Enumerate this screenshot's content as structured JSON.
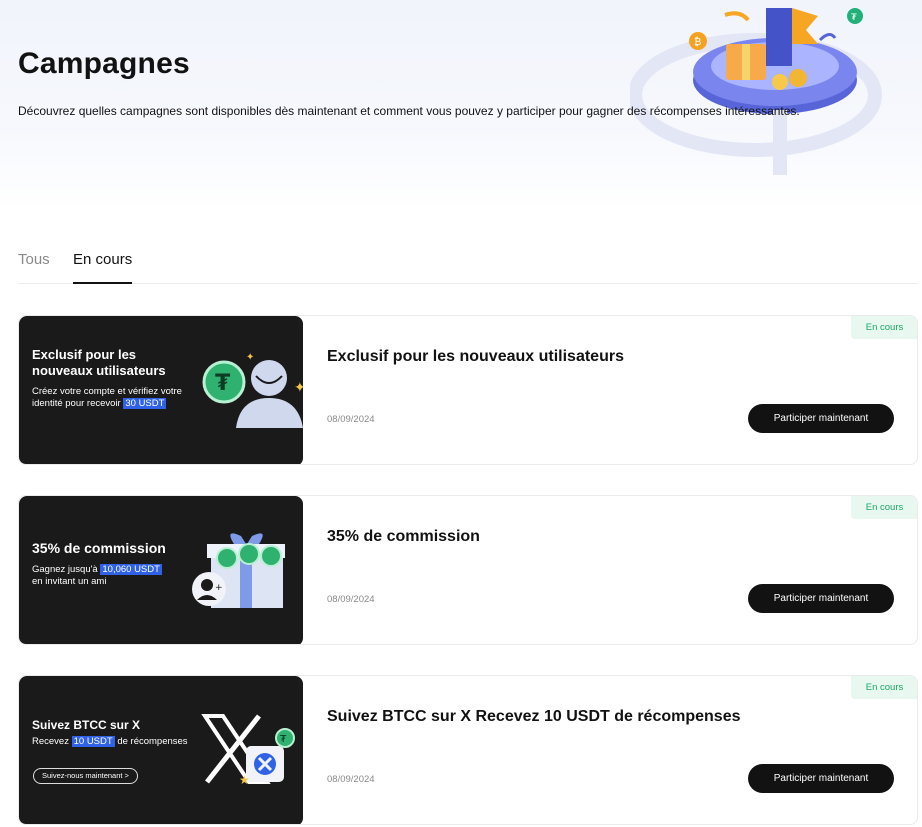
{
  "header": {
    "title": "Campagnes",
    "subtitle": "Découvrez quelles campagnes sont disponibles dès maintenant et comment vous pouvez y participer pour gagner des récompenses intéressantes."
  },
  "tabs": [
    {
      "label": "Tous",
      "active": false
    },
    {
      "label": "En cours",
      "active": true
    }
  ],
  "campaigns": [
    {
      "banner_title": "Exclusif pour les\nnouveaux utilisateurs",
      "banner_text_before": "Créez votre compte et vérifiez votre identité pour recevoir",
      "banner_highlight": "30 USDT",
      "banner_text_after": "",
      "title": "Exclusif pour les nouveaux utilisateurs",
      "date": "08/09/2024",
      "cta": "Participer maintenant",
      "status": "En cours"
    },
    {
      "banner_title": "35% de commission",
      "banner_text_before": "Gagnez jusqu'à",
      "banner_highlight": "10,060 USDT",
      "banner_text_after": "en invitant un ami",
      "title": "35% de commission",
      "date": "08/09/2024",
      "cta": "Participer maintenant",
      "status": "En cours"
    },
    {
      "banner_title": "Suivez BTCC sur X",
      "banner_text_before": "Recevez",
      "banner_highlight": "10 USDT",
      "banner_text_after": "de récompenses",
      "banner_pill": "Suivez-nous maintenant >",
      "title": "Suivez BTCC sur X  Recevez 10 USDT de récompenses",
      "date": "08/09/2024",
      "cta": "Participer maintenant",
      "status": "En cours"
    }
  ],
  "colors": {
    "accent": "#121212",
    "highlight": "#2f62e6",
    "status_green": "#1aa864",
    "status_bg": "#e8f7ef",
    "banner_bg": "#1a1a1a"
  },
  "icons": [
    "tether-coin-icon",
    "user-avatar-icon",
    "gift-box-icon",
    "add-user-icon",
    "x-logo-icon",
    "btcc-logo-icon",
    "sparkle-icon"
  ]
}
